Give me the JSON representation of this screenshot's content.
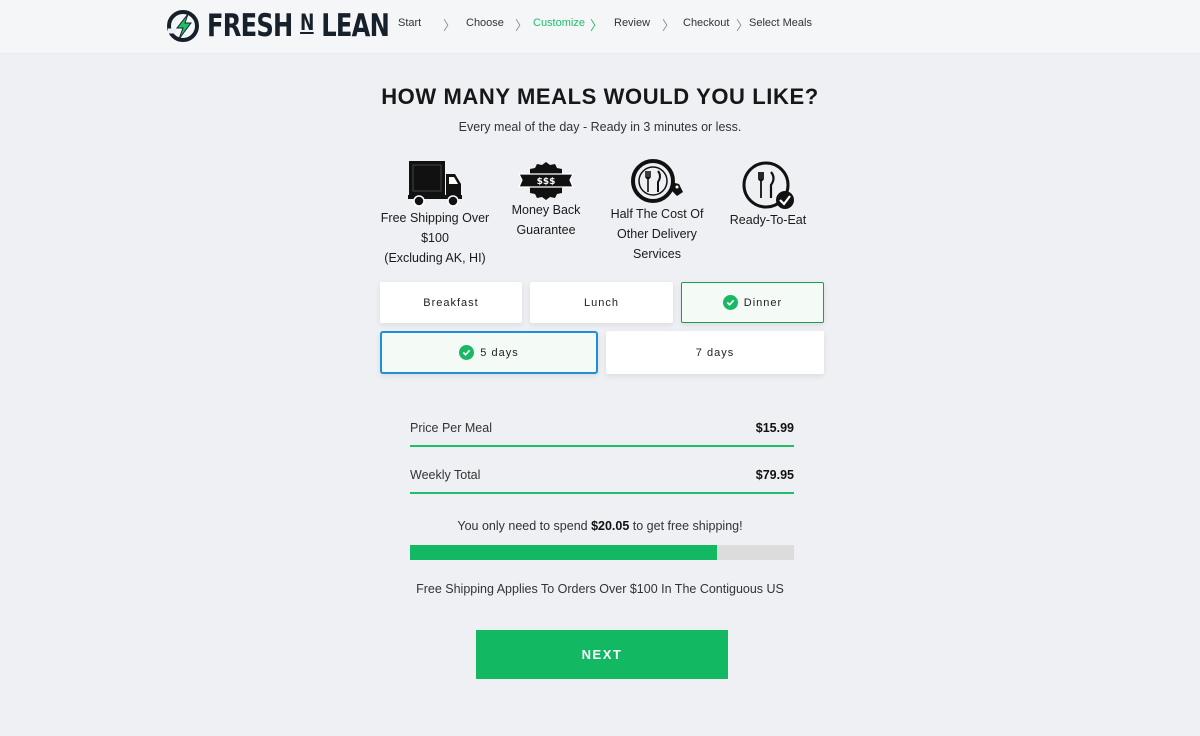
{
  "brand": {
    "name_part1": "FRESH",
    "name_n": "N",
    "name_part2": "LEAN"
  },
  "steps": [
    {
      "label": "Start",
      "active": false
    },
    {
      "label": "Choose",
      "active": false
    },
    {
      "label": "Customize",
      "active": true
    },
    {
      "label": "Review",
      "active": false
    },
    {
      "label": "Checkout",
      "active": false
    },
    {
      "label": "Select Meals",
      "active": false
    }
  ],
  "title": "HOW MANY MEALS WOULD YOU LIKE?",
  "subtitle": "Every meal of the day - Ready in 3 minutes or less.",
  "features": [
    {
      "icon": "truck-icon",
      "lines": [
        "Free Shipping Over",
        "$100",
        "(Excluding AK, HI)"
      ]
    },
    {
      "icon": "money-badge-icon",
      "badge_text": "$$$",
      "lines": [
        "Money Back",
        "Guarantee"
      ]
    },
    {
      "icon": "plate-price-tag-icon",
      "lines": [
        "Half The Cost Of",
        "Other Delivery",
        "Services"
      ]
    },
    {
      "icon": "plate-check-icon",
      "lines": [
        "Ready-To-Eat"
      ]
    }
  ],
  "meals": [
    {
      "label": "Breakfast",
      "selected": false
    },
    {
      "label": "Lunch",
      "selected": false
    },
    {
      "label": "Dinner",
      "selected": true
    }
  ],
  "days": [
    {
      "label": "5 days",
      "selected": true
    },
    {
      "label": "7 days",
      "selected": false
    }
  ],
  "pricing": {
    "per_meal_label": "Price Per Meal",
    "per_meal_value": "$15.99",
    "weekly_label": "Weekly Total",
    "weekly_value": "$79.95"
  },
  "shipping": {
    "msg_before": "You only need to spend ",
    "msg_amount": "$20.05",
    "msg_after": " to get free shipping!",
    "progress_fraction": 0.7995,
    "note": "Free Shipping Applies To Orders Over $100 In The Contiguous US"
  },
  "next_label": "NEXT",
  "colors": {
    "accent": "#12b862",
    "selected_border_blue": "#1e8fd8",
    "dark": "#17212b"
  }
}
